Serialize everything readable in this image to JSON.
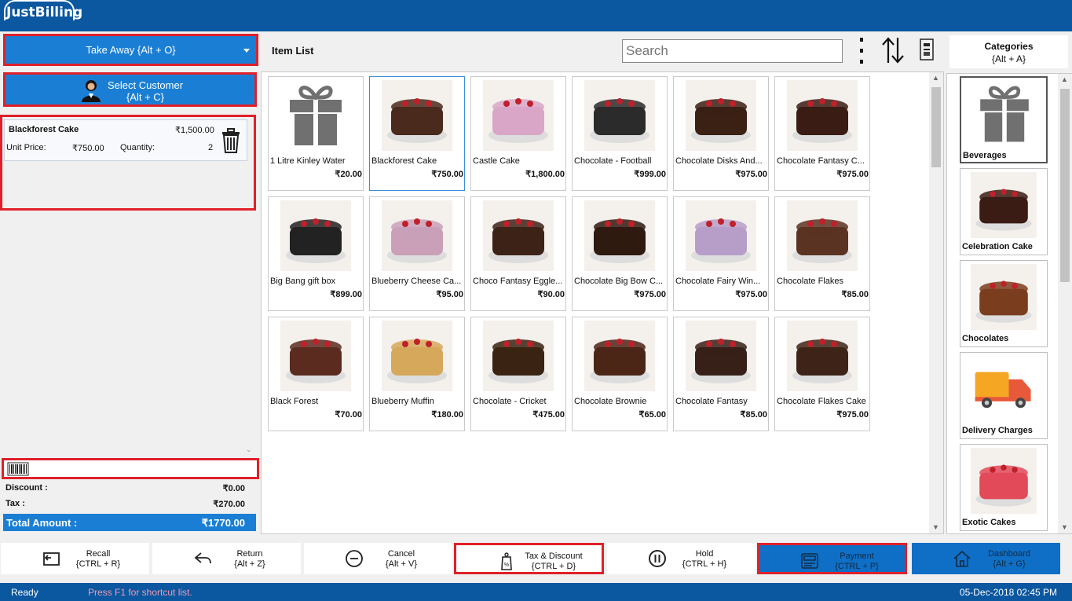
{
  "app": {
    "logo": "JustBilling"
  },
  "left": {
    "order_type": "Take Away {Alt + O}",
    "customer_line1": "Select Customer",
    "customer_line2": "{Alt + C}",
    "cart": [
      {
        "name": "Blackforest Cake",
        "amount": "₹1,500.00",
        "unit_price_label": "Unit Price:",
        "unit_price": "₹750.00",
        "quantity_label": "Quantity:",
        "quantity": "2"
      }
    ],
    "discount_label": "Discount :",
    "discount": "₹0.00",
    "tax_label": "Tax :",
    "tax": "₹270.00",
    "total_label": "Total Amount :",
    "total": "₹1770.00"
  },
  "center": {
    "title": "Item List",
    "search_placeholder": "Search",
    "items": [
      {
        "name": "1 Litre Kinley Water",
        "price": "₹20.00",
        "icon": "gift-icon",
        "color": "#707070"
      },
      {
        "name": "Blackforest Cake",
        "price": "₹750.00",
        "icon": "cake-photo",
        "color": "#4a2a1c"
      },
      {
        "name": "Castle Cake",
        "price": "₹1,800.00",
        "icon": "cake-photo",
        "color": "#d9a6c8"
      },
      {
        "name": "Chocolate - Football",
        "price": "₹999.00",
        "icon": "chocolate-photo",
        "color": "#2b2b2b"
      },
      {
        "name": "Chocolate Disks And...",
        "price": "₹975.00",
        "icon": "cake-photo",
        "color": "#3b2014"
      },
      {
        "name": "Chocolate Fantasy C...",
        "price": "₹975.00",
        "icon": "cake-photo",
        "color": "#3a1c14"
      },
      {
        "name": "Big Bang gift box",
        "price": "₹899.00",
        "icon": "gift-box-photo",
        "color": "#222222"
      },
      {
        "name": "Blueberry Cheese Ca...",
        "price": "₹95.00",
        "icon": "cake-photo",
        "color": "#c9a0b8"
      },
      {
        "name": "Choco Fantasy Eggle...",
        "price": "₹90.00",
        "icon": "cake-photo",
        "color": "#3d2217"
      },
      {
        "name": "Chocolate Big Bow C...",
        "price": "₹975.00",
        "icon": "cake-photo",
        "color": "#2f1a10"
      },
      {
        "name": "Chocolate Fairy Win...",
        "price": "₹975.00",
        "icon": "cupcake-photo",
        "color": "#b79ec9"
      },
      {
        "name": "Chocolate Flakes",
        "price": "₹85.00",
        "icon": "brownie-photo",
        "color": "#5a3322"
      },
      {
        "name": "Black Forest",
        "price": "₹70.00",
        "icon": "cake-photo",
        "color": "#5b2b20"
      },
      {
        "name": "Blueberry Muffin",
        "price": "₹180.00",
        "icon": "muffin-photo",
        "color": "#d6a85c"
      },
      {
        "name": "Chocolate - Cricket",
        "price": "₹475.00",
        "icon": "cake-photo",
        "color": "#3a2312"
      },
      {
        "name": "Chocolate Brownie",
        "price": "₹65.00",
        "icon": "brownie-photo",
        "color": "#4b2617"
      },
      {
        "name": "Chocolate Fantasy",
        "price": "₹85.00",
        "icon": "cake-photo",
        "color": "#362018"
      },
      {
        "name": "Chocolate Flakes Cake",
        "price": "₹975.00",
        "icon": "cake-photo",
        "color": "#3e2418"
      }
    ]
  },
  "categories": {
    "title": "Categories",
    "shortcut": "{Alt + A}",
    "items": [
      {
        "name": "Beverages",
        "icon": "gift-icon",
        "color": "#707070"
      },
      {
        "name": "Celebration Cake",
        "icon": "cake-photo",
        "color": "#3a1c14"
      },
      {
        "name": "Chocolates",
        "icon": "chocolate-photo",
        "color": "#7a3d1e"
      },
      {
        "name": "Delivery Charges",
        "icon": "truck-icon",
        "color": "#e8593a"
      },
      {
        "name": "Exotic Cakes",
        "icon": "cake-photo",
        "color": "#e24a5a"
      }
    ]
  },
  "bottom": [
    {
      "label": "Recall",
      "shortcut": "{CTRL + R}",
      "icon": "recall-icon"
    },
    {
      "label": "Return",
      "shortcut": "{Alt + Z}",
      "icon": "return-icon"
    },
    {
      "label": "Cancel",
      "shortcut": "{Alt + V}",
      "icon": "cancel-icon"
    },
    {
      "label": "Tax & Discount",
      "shortcut": "{CTRL + D}",
      "icon": "tax-tag-icon"
    },
    {
      "label": "Hold",
      "shortcut": "{CTRL + H}",
      "icon": "pause-icon"
    },
    {
      "label": "Payment",
      "shortcut": "{CTRL + P}",
      "icon": "payment-icon"
    },
    {
      "label": "Dashboard",
      "shortcut": "{Alt + G}",
      "icon": "home-icon"
    }
  ],
  "status": {
    "state": "Ready",
    "hint": "Press F1 for shortcut list.",
    "datetime": "05-Dec-2018 02:45 PM"
  },
  "colors": {
    "header": "#0b57a0",
    "button_blue": "#1a7fd4",
    "highlight": "#e0202a"
  }
}
